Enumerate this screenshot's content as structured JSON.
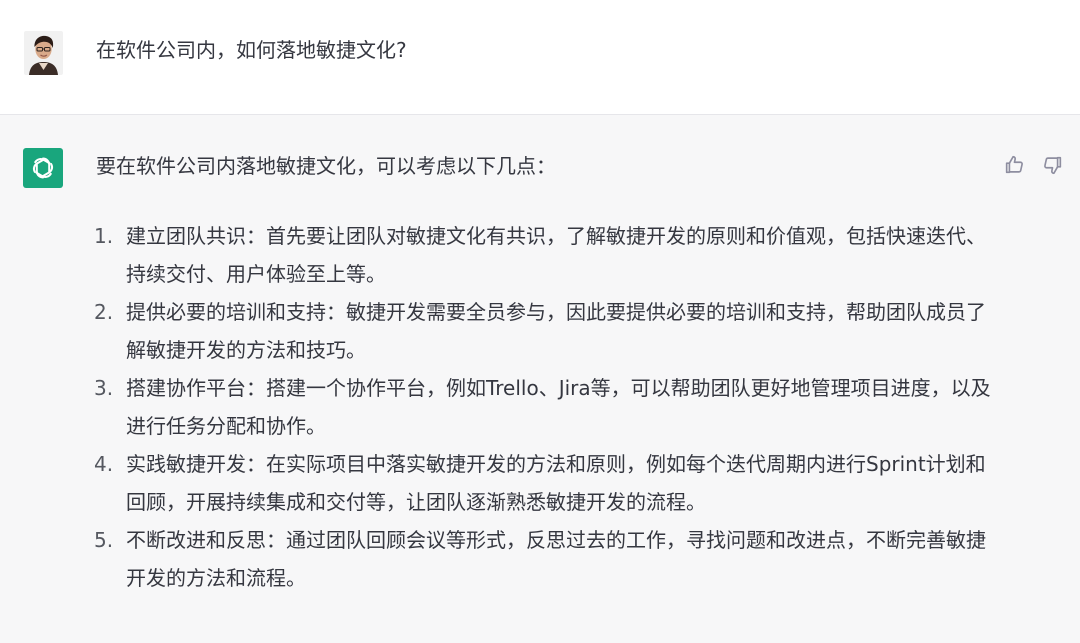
{
  "user_message": {
    "avatar": "user-avatar-photo",
    "text": "在软件公司内，如何落地敏捷文化?"
  },
  "assistant_message": {
    "avatar": "openai-logo-icon",
    "accent_color": "#19a67d",
    "intro": "要在软件公司内落地敏捷文化，可以考虑以下几点：",
    "points": [
      {
        "number": "1.",
        "text": "建立团队共识：首先要让团队对敏捷文化有共识，了解敏捷开发的原则和价值观，包括快速迭代、持续交付、用户体验至上等。"
      },
      {
        "number": "2.",
        "text": "提供必要的培训和支持：敏捷开发需要全员参与，因此要提供必要的培训和支持，帮助团队成员了解敏捷开发的方法和技巧。"
      },
      {
        "number": "3.",
        "text": "搭建协作平台：搭建一个协作平台，例如Trello、Jira等，可以帮助团队更好地管理项目进度，以及进行任务分配和协作。"
      },
      {
        "number": "4.",
        "text": "实践敏捷开发：在实际项目中落实敏捷开发的方法和原则，例如每个迭代周期内进行Sprint计划和回顾，开展持续集成和交付等，让团队逐渐熟悉敏捷开发的流程。"
      },
      {
        "number": "5.",
        "text": "不断改进和反思：通过团队回顾会议等形式，反思过去的工作，寻找问题和改进点，不断完善敏捷开发的方法和流程。"
      }
    ],
    "feedback": {
      "like_icon": "thumbs-up-icon",
      "dislike_icon": "thumbs-down-icon"
    }
  }
}
